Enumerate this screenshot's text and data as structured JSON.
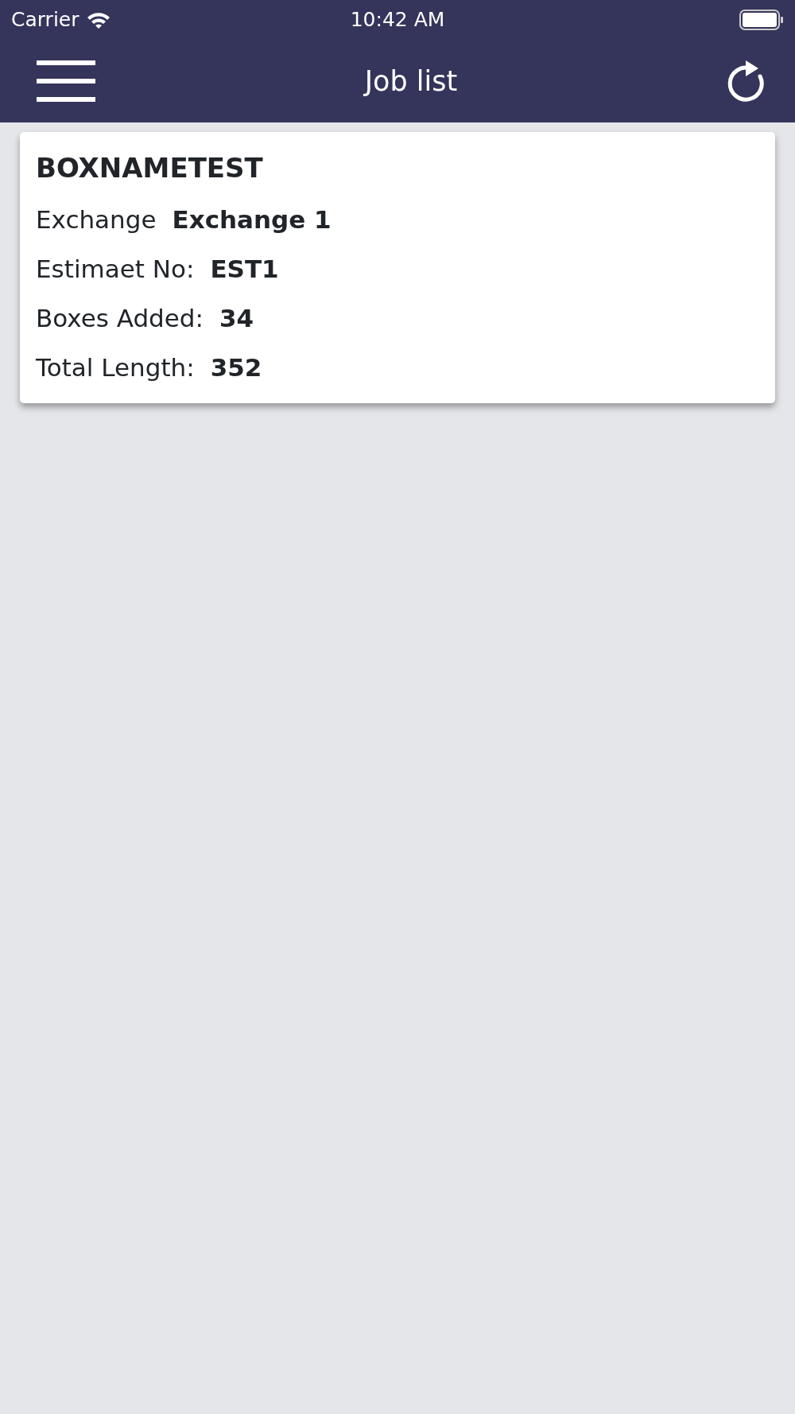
{
  "status_bar": {
    "carrier": "Carrier",
    "time": "10:42 AM"
  },
  "header": {
    "title": "Job list"
  },
  "jobs": [
    {
      "title": "BOXNAMETEST",
      "fields": [
        {
          "label": "Exchange",
          "value": "Exchange 1"
        },
        {
          "label": "Estimaet No:",
          "value": "EST1"
        },
        {
          "label": "Boxes Added:",
          "value": "34"
        },
        {
          "label": "Total Length:",
          "value": "352"
        }
      ]
    }
  ]
}
